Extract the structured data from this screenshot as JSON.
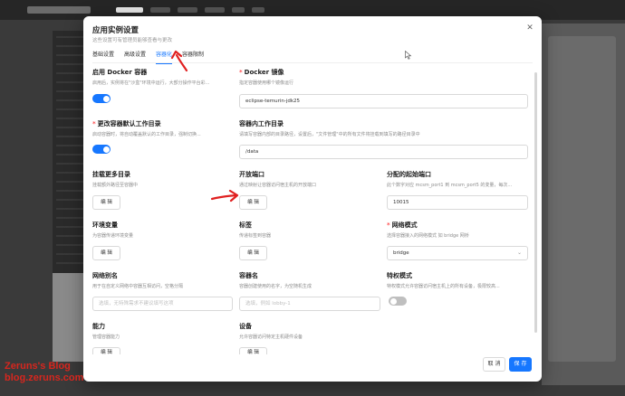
{
  "background": {
    "logo_text": "MCSMANAGER"
  },
  "modal": {
    "title": "应用实例设置",
    "subtitle": "这些设置可有管理员能够查看与更改",
    "tabs": [
      {
        "label": "基础设置",
        "active": false
      },
      {
        "label": "高级设置",
        "active": false
      },
      {
        "label": "容器化",
        "active": true
      },
      {
        "label": "容器限制",
        "active": false
      }
    ],
    "fields": {
      "enable_docker": {
        "label": "启用 Docker 容器",
        "desc": "启用后，实例将在\"沙盒\"环境中运行，大部分操作平台彩...",
        "value": true
      },
      "docker_image": {
        "label": "Docker 镜像",
        "required": true,
        "desc": "指定容器使用哪个镜像运行",
        "value": "eclipse-temurin-jdk25"
      },
      "change_workdir": {
        "label": "更改容器默认工作目录",
        "required": true,
        "desc": "启动容器时，将自动覆盖默认的工作目录，强制切换...",
        "value": true
      },
      "container_workdir": {
        "label": "容器内工作目录",
        "desc": "请填写容器内部的目录路径，设置后，\"文件管理\"中的所有文件将挂载到填写的路径目录中",
        "value": "/data"
      },
      "mount_more": {
        "label": "挂载更多目录",
        "desc": "挂载额外路径至容器中",
        "button": "编 辑"
      },
      "open_ports": {
        "label": "开放端口",
        "desc": "通过映射让容器访问宿主机的开放端口",
        "button": "编 辑"
      },
      "port_start": {
        "label": "分配的起始端口",
        "desc": "此个数字对应 mcsm_port1 到 mcsm_port5 的变量，每次...",
        "value": "10015"
      },
      "env_vars": {
        "label": "环境变量",
        "desc": "为容器传递环境变量",
        "button": "编 辑"
      },
      "labels": {
        "label": "标签",
        "desc": "传递标签到容器",
        "button": "编 辑"
      },
      "network_mode": {
        "label": "网络模式",
        "required": true,
        "desc": "选择容器接入的网络模式 如 bridge 网桥",
        "value": "bridge"
      },
      "network_alias": {
        "label": "网络别名",
        "desc": "用于在自定义网络中容器互相访问，空格分隔",
        "placeholder": "选填，无特殊需求不建议填写这项"
      },
      "container_name": {
        "label": "容器名",
        "desc": "容器创建使用的名字，为空随机生成",
        "placeholder": "选填，例如 lobby-1"
      },
      "privileged": {
        "label": "特权模式",
        "desc": "特权模式允许容器访问宿主机上的所有设备，极限较高...",
        "value": false
      },
      "capabilities": {
        "label": "能力",
        "desc": "管理容器能力",
        "button": "编 辑"
      },
      "devices": {
        "label": "设备",
        "desc": "允许容器访问特定主机硬件设备",
        "button": "编 辑"
      }
    },
    "footer": {
      "cancel": "取 消",
      "save": "保 存"
    }
  },
  "watermark": {
    "line1": "Zeruns's Blog",
    "line2": "blog.zeruns.com"
  },
  "colors": {
    "accent": "#1677ff",
    "required": "#ff4d4f",
    "annotation": "#e02020"
  }
}
